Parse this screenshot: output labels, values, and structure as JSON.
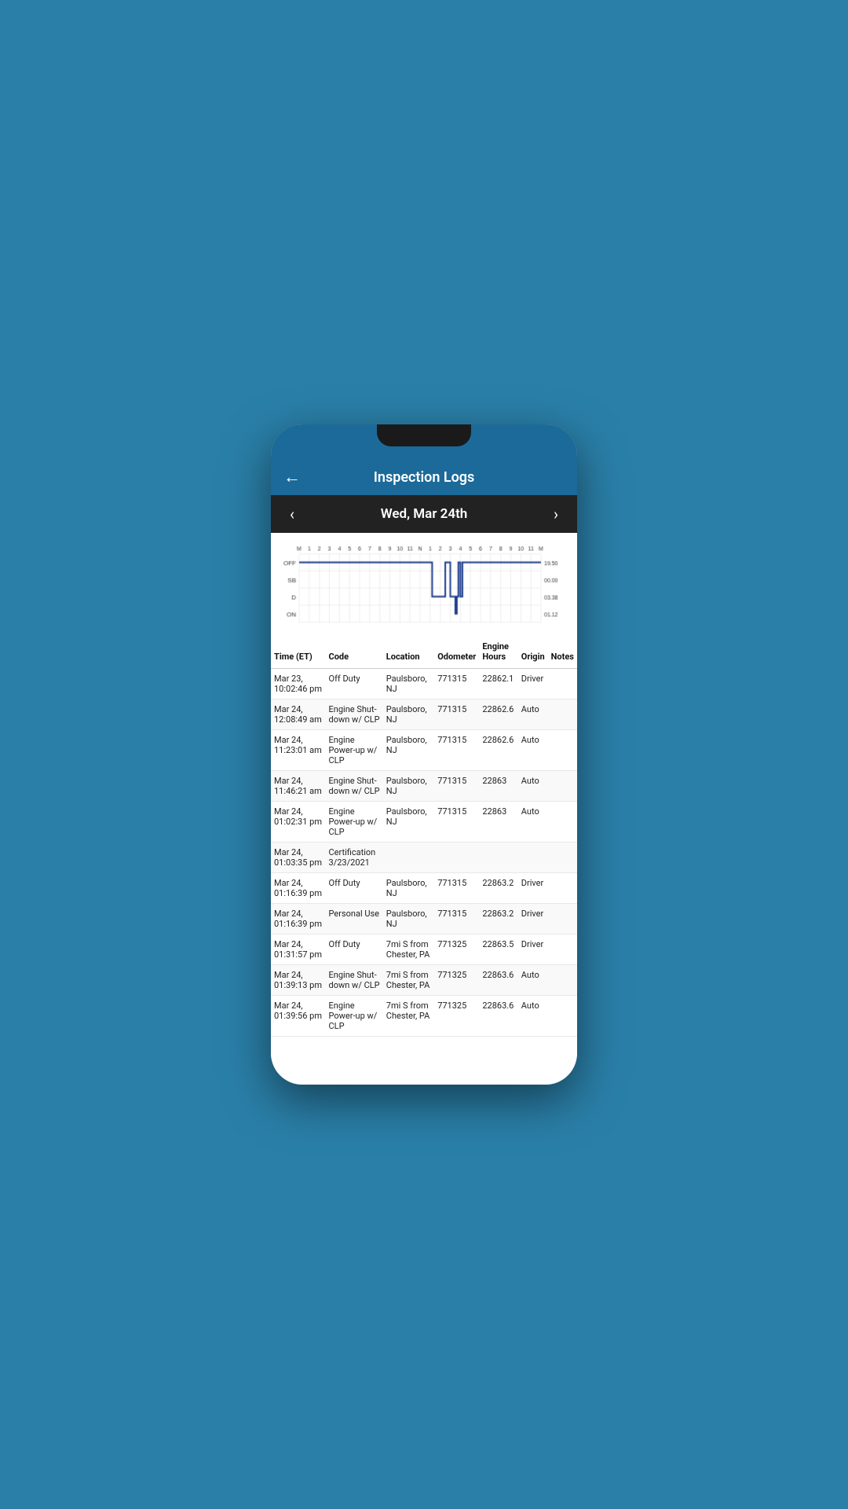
{
  "header": {
    "title": "Inspection Logs",
    "back_label": "←"
  },
  "date_nav": {
    "label": "Wed, Mar 24th",
    "prev_arrow": "‹",
    "next_arrow": "›"
  },
  "chart": {
    "rows": [
      "OFF",
      "SB",
      "D",
      "ON"
    ],
    "totals": [
      "19.50",
      "00.00",
      "03.38",
      "01.12"
    ],
    "time_labels": [
      "M",
      "1",
      "2",
      "3",
      "4",
      "5",
      "6",
      "7",
      "8",
      "9",
      "10",
      "11",
      "N",
      "1",
      "2",
      "3",
      "4",
      "5",
      "6",
      "7",
      "8",
      "9",
      "10",
      "11",
      "M"
    ]
  },
  "table": {
    "headers": [
      "Time (ET)",
      "Code",
      "Location",
      "Odometer",
      "Engine Hours",
      "Origin",
      "Notes"
    ],
    "rows": [
      {
        "time": "Mar 23, 10:02:46 pm",
        "code": "Off Duty",
        "location": "Paulsboro, NJ",
        "odometer": "771315",
        "engine_hours": "22862.1",
        "origin": "Driver",
        "notes": ""
      },
      {
        "time": "Mar 24, 12:08:49 am",
        "code": "Engine Shut-down w/ CLP",
        "location": "Paulsboro, NJ",
        "odometer": "771315",
        "engine_hours": "22862.6",
        "origin": "Auto",
        "notes": ""
      },
      {
        "time": "Mar 24, 11:23:01 am",
        "code": "Engine Power-up w/ CLP",
        "location": "Paulsboro, NJ",
        "odometer": "771315",
        "engine_hours": "22862.6",
        "origin": "Auto",
        "notes": ""
      },
      {
        "time": "Mar 24, 11:46:21 am",
        "code": "Engine Shut-down w/ CLP",
        "location": "Paulsboro, NJ",
        "odometer": "771315",
        "engine_hours": "22863",
        "origin": "Auto",
        "notes": ""
      },
      {
        "time": "Mar 24, 01:02:31 pm",
        "code": "Engine Power-up w/ CLP",
        "location": "Paulsboro, NJ",
        "odometer": "771315",
        "engine_hours": "22863",
        "origin": "Auto",
        "notes": ""
      },
      {
        "time": "Mar 24, 01:03:35 pm",
        "code": "Certification 3/23/2021",
        "location": "",
        "odometer": "",
        "engine_hours": "",
        "origin": "",
        "notes": ""
      },
      {
        "time": "Mar 24, 01:16:39 pm",
        "code": "Off Duty",
        "location": "Paulsboro, NJ",
        "odometer": "771315",
        "engine_hours": "22863.2",
        "origin": "Driver",
        "notes": ""
      },
      {
        "time": "Mar 24, 01:16:39 pm",
        "code": "Personal Use",
        "location": "Paulsboro, NJ",
        "odometer": "771315",
        "engine_hours": "22863.2",
        "origin": "Driver",
        "notes": ""
      },
      {
        "time": "Mar 24, 01:31:57 pm",
        "code": "Off Duty",
        "location": "7mi S from Chester, PA",
        "odometer": "771325",
        "engine_hours": "22863.5",
        "origin": "Driver",
        "notes": ""
      },
      {
        "time": "Mar 24, 01:39:13 pm",
        "code": "Engine Shut-down w/ CLP",
        "location": "7mi S from Chester, PA",
        "odometer": "771325",
        "engine_hours": "22863.6",
        "origin": "Auto",
        "notes": ""
      },
      {
        "time": "Mar 24, 01:39:56 pm",
        "code": "Engine Power-up w/ CLP",
        "location": "7mi S from Chester, PA",
        "odometer": "771325",
        "engine_hours": "22863.6",
        "origin": "Auto",
        "notes": ""
      }
    ]
  }
}
